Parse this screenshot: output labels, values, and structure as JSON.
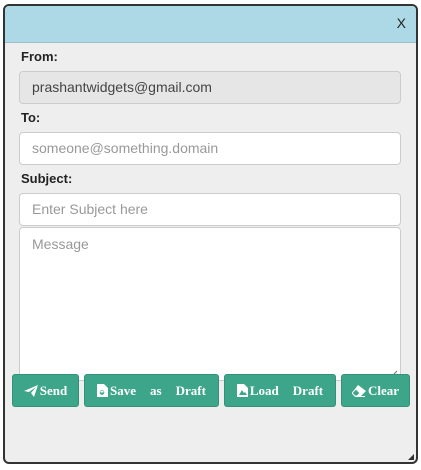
{
  "window": {
    "close_label": "X"
  },
  "form": {
    "from_label": "From:",
    "from_value": "prashantwidgets@gmail.com",
    "to_label": "To:",
    "to_placeholder": "someone@something.domain",
    "subject_label": "Subject:",
    "subject_placeholder": "Enter Subject here",
    "message_placeholder": "Message"
  },
  "buttons": {
    "send": "Send",
    "save_word1": "Save",
    "save_word2": "as",
    "save_word3": "Draft",
    "load_word1": "Load",
    "load_word2": "Draft",
    "clear": "Clear"
  },
  "colors": {
    "titlebar": "#add8e6",
    "button": "#3da58a",
    "panel": "#eeeeee"
  },
  "icons": {
    "send": "paper-plane-icon",
    "save": "save-file-icon",
    "load": "load-file-icon",
    "clear": "eraser-icon"
  }
}
